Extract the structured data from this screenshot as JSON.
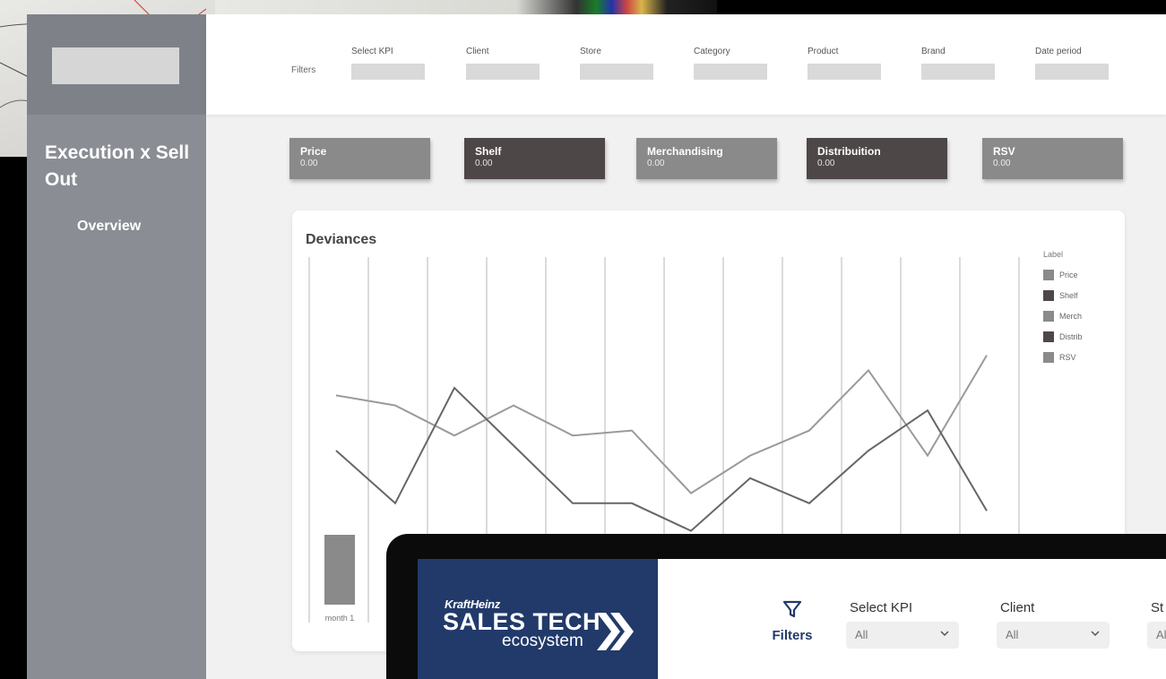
{
  "wireframe": {
    "title": "Execution x Sell Out",
    "nav_item": "Overview",
    "filters_label": "Filters",
    "filters": [
      "Select KPI",
      "Client",
      "Store",
      "Category",
      "Product",
      "Brand",
      "Date period"
    ],
    "kpis": [
      {
        "name": "Price",
        "value": "0.00",
        "tone": "light"
      },
      {
        "name": "Shelf",
        "value": "0.00",
        "tone": "dark"
      },
      {
        "name": "Merchandising",
        "value": "0.00",
        "tone": "light"
      },
      {
        "name": "Distribuition",
        "value": "0.00",
        "tone": "dark"
      },
      {
        "name": "RSV",
        "value": "0.00",
        "tone": "light"
      }
    ],
    "chart_title": "Deviances",
    "legend_title": "Label",
    "legend": [
      {
        "name": "Price",
        "color": "#8a8a8a"
      },
      {
        "name": "Shelf",
        "color": "#4e4747"
      },
      {
        "name": "Merch",
        "color": "#8a8a8a"
      },
      {
        "name": "Distrib",
        "color": "#4e4747"
      },
      {
        "name": "RSV",
        "color": "#8a8a8a"
      }
    ],
    "month_labels": [
      "month 1"
    ]
  },
  "chart_data": {
    "type": "line",
    "title": "Deviances",
    "x": [
      1,
      2,
      3,
      4,
      5,
      6,
      7,
      8,
      9,
      10,
      11,
      12
    ],
    "ylim": [
      0,
      100
    ],
    "series": [
      {
        "values": [
          62,
          58,
          46,
          58,
          46,
          48,
          23,
          38,
          48,
          72,
          38,
          78
        ],
        "color": "#9a9a9a"
      },
      {
        "values": [
          40,
          19,
          65,
          42,
          19,
          19,
          8,
          29,
          19,
          40,
          56,
          16
        ],
        "color": "#666666"
      }
    ],
    "bars": [
      {
        "label": "month 1",
        "value": 30
      }
    ]
  },
  "laptop": {
    "brand_top": "KraftHeinz",
    "brand_main": "SALES TECH",
    "brand_sub": "ecosystem",
    "filters_label": "Filters",
    "selects": [
      {
        "label": "Select KPI",
        "value": "All"
      },
      {
        "label": "Client",
        "value": "All"
      },
      {
        "label": "St",
        "value": "Al"
      }
    ],
    "brand_color": "#213a6a"
  }
}
